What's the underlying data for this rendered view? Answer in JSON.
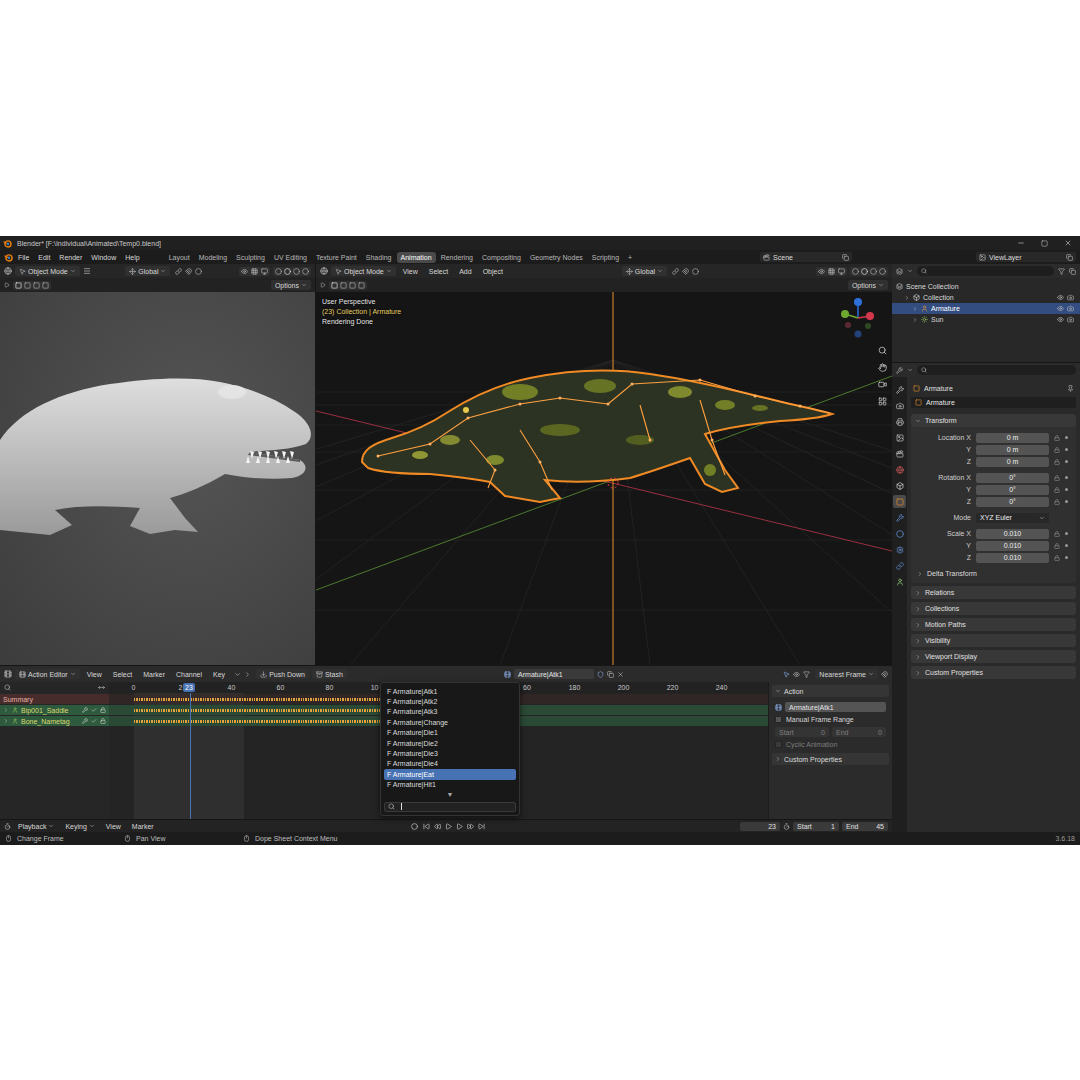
{
  "window": {
    "title": "Blender* [F:\\Individual\\Animated\\Temp0.blend]"
  },
  "menu": [
    "File",
    "Edit",
    "Render",
    "Window",
    "Help"
  ],
  "workspaces": [
    {
      "label": "Layout",
      "selected": false
    },
    {
      "label": "Modeling",
      "selected": false
    },
    {
      "label": "Sculpting",
      "selected": false
    },
    {
      "label": "UV Editing",
      "selected": false
    },
    {
      "label": "Texture Paint",
      "selected": false
    },
    {
      "label": "Shading",
      "selected": false
    },
    {
      "label": "Animation",
      "selected": true
    },
    {
      "label": "Rendering",
      "selected": false
    },
    {
      "label": "Compositing",
      "selected": false
    },
    {
      "label": "Geometry Nodes",
      "selected": false
    },
    {
      "label": "Scripting",
      "selected": false
    }
  ],
  "add_workspace": "+",
  "scene": "Scene",
  "view_layer": "ViewLayer",
  "left_viewport": {
    "mode": "Object Mode",
    "orientation": "Global",
    "options": "Options"
  },
  "main_viewport": {
    "mode": "Object Mode",
    "menus": [
      "View",
      "Select",
      "Add",
      "Object"
    ],
    "orientation": "Global",
    "options": "Options",
    "overlay": [
      {
        "text": "User Perspective",
        "highlight": false
      },
      {
        "text": "(23) Collection | Armature",
        "highlight": true
      },
      {
        "text": "Rendering Done",
        "highlight": false
      }
    ]
  },
  "outliner": {
    "items": [
      {
        "label": "Scene Collection",
        "kind": "scene",
        "depth": 0,
        "selected": false
      },
      {
        "label": "Collection",
        "kind": "collection",
        "depth": 1,
        "selected": false
      },
      {
        "label": "Armature",
        "kind": "armature",
        "depth": 2,
        "selected": true
      },
      {
        "label": "Sun",
        "kind": "light",
        "depth": 2,
        "selected": false
      }
    ]
  },
  "properties": {
    "tabs": [
      {
        "selected": false
      },
      {
        "selected": false
      },
      {
        "selected": false
      },
      {
        "selected": false
      },
      {
        "selected": false
      },
      {
        "selected": false
      },
      {
        "selected": false
      },
      {
        "selected": true
      },
      {
        "selected": false
      },
      {
        "selected": false
      },
      {
        "selected": false
      },
      {
        "selected": false
      },
      {
        "selected": false
      }
    ],
    "object": "Armature",
    "name": "Armature",
    "transform": {
      "title": "Transform",
      "expanded": true,
      "groups": [
        [
          {
            "label": "Location X",
            "value": "0 m",
            "kind": "number"
          },
          {
            "label": "Y",
            "value": "0 m",
            "kind": "number"
          },
          {
            "label": "Z",
            "value": "0 m",
            "kind": "number"
          }
        ],
        [
          {
            "label": "Rotation X",
            "value": "0°",
            "kind": "number"
          },
          {
            "label": "Y",
            "value": "0°",
            "kind": "number"
          },
          {
            "label": "Z",
            "value": "0°",
            "kind": "number"
          }
        ],
        [
          {
            "label": "Mode",
            "value": "XYZ Euler",
            "kind": "select"
          }
        ],
        [
          {
            "label": "Scale X",
            "value": "0.010",
            "kind": "number"
          },
          {
            "label": "Y",
            "value": "0.010",
            "kind": "number"
          },
          {
            "label": "Z",
            "value": "0.010",
            "kind": "number"
          }
        ]
      ],
      "sub": {
        "title": "Delta Transform",
        "expanded": false
      }
    },
    "sections": [
      {
        "title": "Relations",
        "expanded": false
      },
      {
        "title": "Collections",
        "expanded": false
      },
      {
        "title": "Motion Paths",
        "expanded": false
      },
      {
        "title": "Visibility",
        "expanded": false
      },
      {
        "title": "Viewport Display",
        "expanded": false
      },
      {
        "title": "Custom Properties",
        "expanded": false
      }
    ]
  },
  "action_editor": {
    "editor": "Action Editor",
    "menus": [
      "View",
      "Select",
      "Marker",
      "Channel",
      "Key"
    ],
    "buttons": [
      "Push Down",
      "Stash"
    ],
    "action": "Armature|Atk1",
    "snapping": "Nearest Frame",
    "current_frame": "23",
    "ruler": {
      "before_menu": [
        {
          "label": "0",
          "kind": "full"
        },
        {
          "label": "2",
          "kind": "cut-end"
        },
        {
          "label": "40",
          "kind": "full"
        },
        {
          "label": "60",
          "kind": "full"
        },
        {
          "label": "80",
          "kind": "full"
        },
        {
          "label": "10",
          "kind": "cut-end"
        }
      ],
      "after_menu": [
        {
          "label": "60",
          "kind": "cut-start"
        },
        {
          "label": "180",
          "kind": "full"
        },
        {
          "label": "200",
          "kind": "full"
        },
        {
          "label": "220",
          "kind": "full"
        },
        {
          "label": "240",
          "kind": "full"
        }
      ]
    },
    "channels": [
      {
        "label": "Summary",
        "kind": "summary"
      },
      {
        "label": "Bip001_Saddle",
        "kind": "bone"
      },
      {
        "label": "Bone_Nametag",
        "kind": "bone"
      }
    ],
    "action_menu": {
      "items": [
        {
          "label": "F Armature|Atk1",
          "selected": false
        },
        {
          "label": "F Armature|Atk2",
          "selected": false
        },
        {
          "label": "F Armature|Atk3",
          "selected": false
        },
        {
          "label": "F Armature|Change",
          "selected": false
        },
        {
          "label": "F Armature|Die1",
          "selected": false
        },
        {
          "label": "F Armature|Die2",
          "selected": false
        },
        {
          "label": "F Armature|Die3",
          "selected": false
        },
        {
          "label": "F Armature|Die4",
          "selected": false
        },
        {
          "label": "F Armature|Eat",
          "selected": true
        },
        {
          "label": "F Armature|Hit1",
          "selected": false
        }
      ],
      "more": "▼",
      "search": ""
    },
    "side_panel": {
      "panel": {
        "label": "Action",
        "expanded": true
      },
      "action": "Armature|Atk1",
      "manual_range": {
        "label": "Manual Frame Range",
        "checked": false,
        "disabled": false
      },
      "start_label": "Start",
      "start": "0",
      "end_label": "End",
      "end": "0",
      "range_disabled": true,
      "cyclic": {
        "label": "Cyclic Animation",
        "checked": false,
        "disabled": true
      },
      "custom": {
        "label": "Custom Properties",
        "expanded": false
      }
    }
  },
  "timeline": {
    "menus": [
      "Playback",
      "Keying",
      "View",
      "Marker"
    ],
    "frame": "23",
    "start_label": "Start",
    "start": "1",
    "end_label": "End",
    "end": "45"
  },
  "status_bar": {
    "items": [
      "Change Frame",
      "Pan View",
      "Dope Sheet Context Menu"
    ],
    "version": "3.6.18"
  }
}
